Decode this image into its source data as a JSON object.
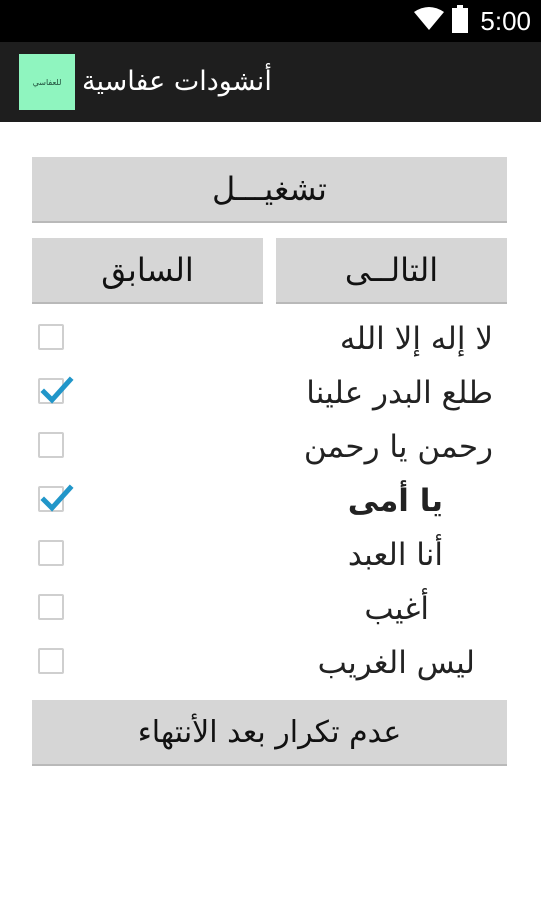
{
  "status_bar": {
    "time": "5:00"
  },
  "action_bar": {
    "app_icon_text": "للعفاسي",
    "title": "أنشودات عفاسية"
  },
  "buttons": {
    "play": "تشغيـــل",
    "next": "التالــى",
    "previous": "السابق",
    "no_repeat": "عدم تكرار بعد الأنتهاء"
  },
  "songs": [
    {
      "title": "لا إله إلا الله",
      "checked": false
    },
    {
      "title": "طلع البدر علينا",
      "checked": true
    },
    {
      "title": "رحمن يا رحمن",
      "checked": false
    },
    {
      "title": "يا أمى",
      "checked": true
    },
    {
      "title": "أنا العبد",
      "checked": false
    },
    {
      "title": "أغيب",
      "checked": false
    },
    {
      "title": "ليس الغريب",
      "checked": false
    }
  ],
  "colors": {
    "check": "#2196c9",
    "app_icon_bg": "#8ff5bf",
    "action_bar": "#1e1e1e"
  }
}
